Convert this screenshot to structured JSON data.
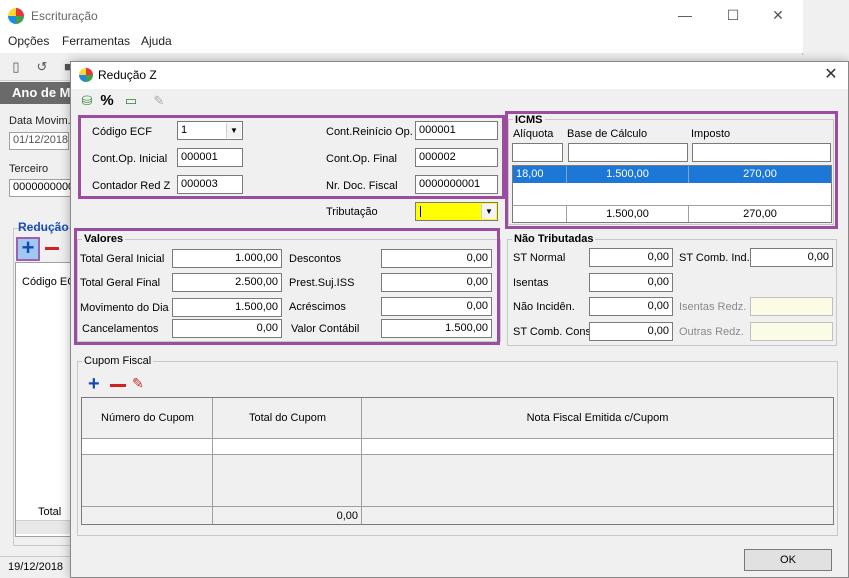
{
  "main_window": {
    "title": "Escrituração",
    "menu": [
      "Opções",
      "Ferramentas",
      "Ajuda"
    ],
    "banner": "Ano de M",
    "data_movim_label": "Data Movim.",
    "data_movim_value": "01/12/2018",
    "terceiro_label": "Terceiro",
    "terceiro_value": "0000000000",
    "reducao_label": "Redução",
    "grid_header": "Código EC",
    "total_label": "Total",
    "status_date": "19/12/2018"
  },
  "dialog": {
    "title": "Redução Z",
    "top_fields": {
      "codigo_ecf_label": "Código ECF",
      "codigo_ecf_value": "1",
      "cont_op_inicial_label": "Cont.Op. Inicial",
      "cont_op_inicial_value": "000001",
      "contador_red_z_label": "Contador Red Z",
      "contador_red_z_value": "000003",
      "cont_reinicio_label": "Cont.Reinício Op.",
      "cont_reinicio_value": "000001",
      "cont_op_final_label": "Cont.Op. Final",
      "cont_op_final_value": "000002",
      "nr_doc_fiscal_label": "Nr. Doc. Fiscal",
      "nr_doc_fiscal_value": "0000000001",
      "tributacao_label": "Tributação",
      "tributacao_value": ""
    },
    "icms": {
      "title": "ICMS",
      "headers": [
        "Alíquota",
        "Base de Cálculo",
        "Imposto"
      ],
      "row": {
        "aliquota": "18,00",
        "base": "1.500,00",
        "imposto": "270,00"
      },
      "totals": {
        "base": "1.500,00",
        "imposto": "270,00"
      }
    },
    "valores": {
      "title": "Valores",
      "total_geral_inicial_label": "Total Geral Inicial",
      "total_geral_inicial_value": "1.000,00",
      "total_geral_final_label": "Total Geral Final",
      "total_geral_final_value": "2.500,00",
      "movimento_dia_label": "Movimento do Dia",
      "movimento_dia_value": "1.500,00",
      "cancelamentos_label": "Cancelamentos",
      "cancelamentos_value": "0,00",
      "descontos_label": "Descontos",
      "descontos_value": "0,00",
      "prest_suj_iss_label": "Prest.Suj.ISS",
      "prest_suj_iss_value": "0,00",
      "acrescimos_label": "Acréscimos",
      "acrescimos_value": "0,00",
      "valor_contabil_label": "Valor Contábil",
      "valor_contabil_value": "1.500,00"
    },
    "nao_tributadas": {
      "title": "Não Tributadas",
      "st_normal_label": "ST Normal",
      "st_normal_value": "0,00",
      "isentas_label": "Isentas",
      "isentas_value": "0,00",
      "nao_incid_label": "Não Incidên.",
      "nao_incid_value": "0,00",
      "st_comb_cons_label": "ST Comb. Cons",
      "st_comb_cons_value": "0,00",
      "st_comb_ind_label": "ST Comb. Ind.",
      "st_comb_ind_value": "0,00",
      "isentas_redz_label": "Isentas Redz.",
      "outras_redz_label": "Outras Redz."
    },
    "cupom_fiscal": {
      "title": "Cupom Fiscal",
      "headers": [
        "Número do Cupom",
        "Total do Cupom",
        "Nota Fiscal Emitida c/Cupom"
      ],
      "total": "0,00"
    },
    "ok_label": "OK"
  },
  "colors": {
    "highlight": "#9b4ea0",
    "selected_row": "#1c77d6",
    "tributacao_bg": "#ffff00",
    "banner": "#6a6a6a"
  }
}
